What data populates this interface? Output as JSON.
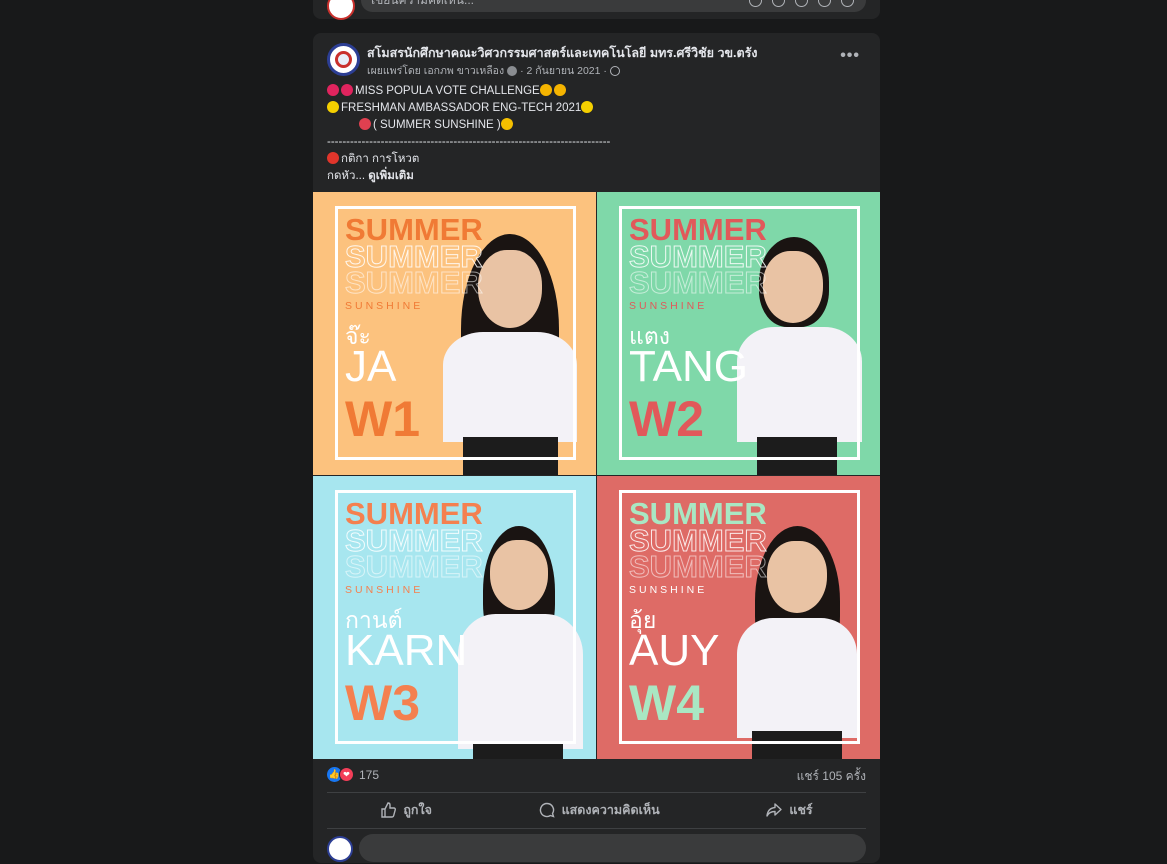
{
  "previous_post": {
    "comment_placeholder": "เขียนความคิดเห็น..."
  },
  "post": {
    "page_name": "สโมสรนักศึกษาคณะวิศวกรรมศาสตร์และเทคโนโลยี มทร.ศรีวิชัย วข.ตรัง",
    "published_by": "เผยแพร่โดย เอกภพ ขาวเหลือง",
    "date": "· 2 กันยายน 2021 ·",
    "more_label": "•••",
    "text_lines": [
      "MISS POPULA VOTE CHALLENGE",
      "FRESHMAN AMBASSADOR ENG-TECH 2021",
      "( SUMMER SUNSHINE )",
      "--------------------------------------------------------------------------",
      "กติกา การโหวต",
      "กดหัว..."
    ],
    "see_more": "ดูเพิ่มเติม",
    "tiles": [
      {
        "bg": "#fcc27e",
        "accent": "#f07a35",
        "summer": "SUMMER",
        "sunshine": "SUNSHINE",
        "thai": "จ๊ะ",
        "name": "JA",
        "code": "W1"
      },
      {
        "bg": "#7fd8a9",
        "accent": "#e1595a",
        "summer": "SUMMER",
        "sunshine": "SUNSHINE",
        "thai": "แตง",
        "name": "TANG",
        "code": "W2"
      },
      {
        "bg": "#a7e6ef",
        "accent": "#f4804f",
        "summer": "SUMMER",
        "sunshine": "SUNSHINE",
        "thai": "กานต์",
        "name": "KARN",
        "code": "W3"
      },
      {
        "bg": "#de6b66",
        "accent": "#a9e7c3",
        "summer": "SUMMER",
        "sunshine": "SUNSHINE",
        "thai": "อุ้ย",
        "name": "AUY",
        "code": "W4"
      }
    ],
    "reaction_count": "175",
    "share_count": "แชร์ 105 ครั้ง",
    "actions": {
      "like": "ถูกใจ",
      "comment": "แสดงความคิดเห็น",
      "share": "แชร์"
    }
  }
}
